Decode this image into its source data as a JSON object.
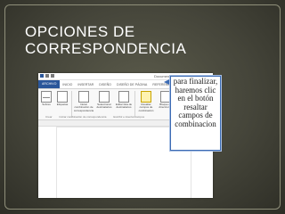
{
  "slide": {
    "title_lines": [
      "OPCIONES DE",
      "CORRESPONDENCIA"
    ]
  },
  "word": {
    "window_title": "Documento1 - Word",
    "tabs": [
      "ARCHIVO",
      "INICIO",
      "INSERTAR",
      "DISEÑO",
      "DISEÑO DE PÁGINA",
      "REFERENCIAS",
      "CORRESPONDENCIA",
      "REVISAR",
      "VISTA"
    ],
    "buttons": [
      {
        "label": "Sobres",
        "icon": "envelope-icon"
      },
      {
        "label": "Etiquetas",
        "icon": "label-icon"
      },
      {
        "label": "Iniciar combinación de correspondencia",
        "icon": "mail-merge-icon"
      },
      {
        "label": "Seleccionar destinatarios",
        "icon": "recipients-icon"
      },
      {
        "label": "Editar lista de destinatarios",
        "icon": "edit-list-icon"
      },
      {
        "label": "Resaltar campos de combinación",
        "icon": "highlight-fields-icon"
      },
      {
        "label": "Bloque de direcciones",
        "icon": "address-block-icon"
      }
    ],
    "groups": [
      "Crear",
      "Iniciar combinación de correspondencia",
      "Escribir e insertar campos"
    ]
  },
  "callout": {
    "lines": [
      "para finalizar,",
      "haremos clic",
      "en el botón",
      "resaltar",
      "campos de",
      "combinacion"
    ]
  }
}
